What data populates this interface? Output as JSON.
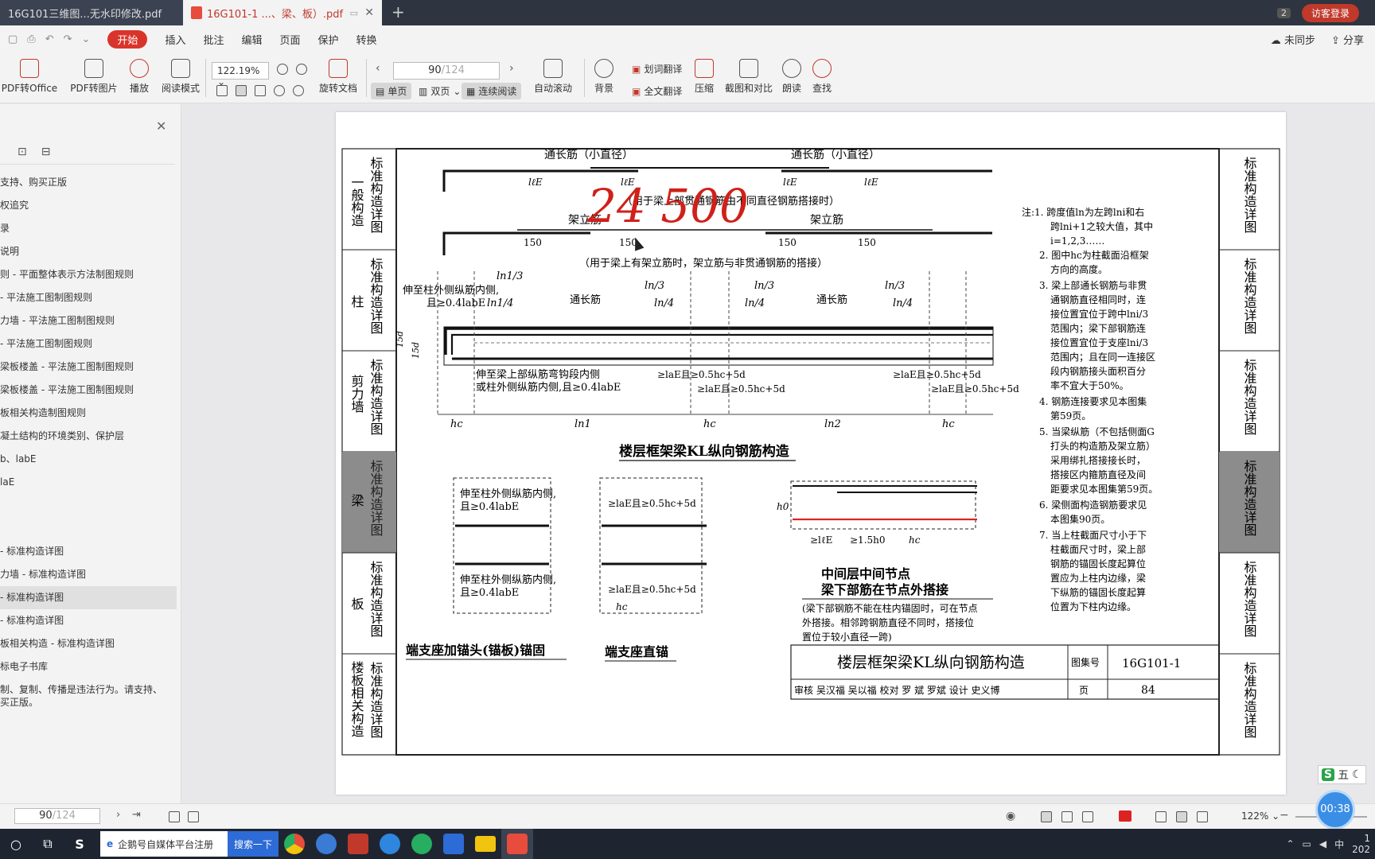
{
  "tabs": [
    {
      "label": "16G101三维图...无水印修改.pdf"
    },
    {
      "label": "16G101-1 ...、梁、板）.pdf"
    }
  ],
  "tabbar": {
    "badge": "2",
    "login": "访客登录"
  },
  "menu": {
    "items": [
      "开始",
      "插入",
      "批注",
      "编辑",
      "页面",
      "保护",
      "转换"
    ],
    "sync": "未同步",
    "share": "分享"
  },
  "toolbar": {
    "pdf_office": "PDF转Office",
    "pdf_image": "PDF转图片",
    "play": "播放",
    "read_mode": "阅读模式",
    "zoom": "122.19%",
    "rotate": "旋转文档",
    "page_current": "90",
    "page_total": "/124",
    "single": "单页",
    "double": "双页",
    "continuous": "连续阅读",
    "autoscroll": "自动滚动",
    "background": "背景",
    "word_translate": "划词翻译",
    "full_translate": "全文翻译",
    "compress": "压缩",
    "screenshot_compare": "截图和对比",
    "read_aloud": "朗读",
    "find": "查找"
  },
  "sidebar": {
    "items": [
      {
        "label": "支持、购买正版"
      },
      {
        "label": "权追究"
      },
      {
        "label": "录"
      },
      {
        "label": "说明"
      },
      {
        "label": "则 - 平面整体表示方法制图规则"
      },
      {
        "label": " - 平法施工图制图规则"
      },
      {
        "label": "力墙 - 平法施工图制图规则"
      },
      {
        "label": " - 平法施工图制图规则"
      },
      {
        "label": "梁板楼盖 - 平法施工图制图规则"
      },
      {
        "label": "梁板楼盖 - 平法施工图制图规则"
      },
      {
        "label": "板相关构造制图规则"
      },
      {
        "label": "凝土结构的环境类别、保护层"
      },
      {
        "label": "b、labE"
      },
      {
        "label": " laE"
      },
      {
        "label": ""
      },
      {
        "label": ""
      },
      {
        "label": " - 标准构造详图"
      },
      {
        "label": "力墙 - 标准构造详图"
      },
      {
        "label": " - 标准构造详图"
      },
      {
        "label": " - 标准构造详图"
      },
      {
        "label": "板相关构造 - 标准构造详图"
      },
      {
        "label": "标电子书库"
      },
      {
        "label": "制、复制、传播是违法行为。请支持、"
      },
      {
        "label": "买正版。"
      }
    ]
  },
  "drawing": {
    "left_tabs": [
      "一般构造",
      "柱",
      "剪力墙",
      "梁",
      "板",
      "楼板相关构造"
    ],
    "side_word": "标准构造详图",
    "top_label_1": "通长筋（小直径）",
    "top_label_2": "通长筋（小直径）",
    "note_1": "（用于梁上部贯通钢筋由不同直径钢筋搭接时）",
    "jlj_1": "架立筋",
    "jlj_2": "架立筋",
    "note_2": "（用于梁上有架立筋时，架立筋与非贯通钢筋的搭接）",
    "v150": "150",
    "lle": "lℓE",
    "ln1_3": "ln1/3",
    "ln1_4": "ln1/4",
    "ln_3": "ln/3",
    "ln_4": "ln/4",
    "tcj": "通长筋",
    "ext_col": "伸至柱外侧纵筋内侧,",
    "ext_col2": "且≥0.4labE",
    "ext_beam": "伸至梁上部纵筋弯钩段内侧",
    "ext_beam2": "或柱外侧纵筋内侧,且≥0.4labE",
    "lae_05": "≥laE且≥0.5hc+5d",
    "d15": "15d",
    "hc": "hc",
    "ln1": "ln1",
    "ln2": "ln2",
    "h0": "h0",
    "l15h0": "≥1.5h0",
    "lle2": "≥lℓE",
    "main_title": "楼层框架梁KL纵向钢筋构造",
    "mid_title_1": "中间层中间节点",
    "mid_title_2": "梁下部筋在节点外搭接",
    "mid_note_1": "(梁下部钢筋不能在柱内锚固时，可在节点",
    "mid_note_2": "外搭接。相邻跨钢筋直径不同时，搭接位",
    "mid_note_3": "置位于较小直径一跨)",
    "end_anchor_1": "端支座加锚头(锚板)锚固",
    "end_anchor_2": "端支座直锚",
    "notes": [
      "注:1. 跨度值ln为左跨lni和右",
      "跨lni+1之较大值，其中",
      "i=1,2,3……",
      "2. 图中hc为柱截面沿框架",
      "方向的高度。",
      "3. 梁上部通长钢筋与非贯",
      "通钢筋直径相同时，连",
      "接位置宜位于跨中lni/3",
      "范围内；梁下部钢筋连",
      "接位置宜位于支座lni/3",
      "范围内；且在同一连接区",
      "段内钢筋接头面积百分",
      "率不宜大于50%。",
      "4. 钢筋连接要求见本图集",
      "第59页。",
      "5. 当梁纵筋（不包括侧面G",
      "打头的构造筋及架立筋）",
      "采用绑扎搭接接长时，",
      "搭接区内箍筋直径及间",
      "距要求见本图集第59页。",
      "6. 梁侧面构造钢筋要求见",
      "本图集90页。",
      "7. 当上柱截面尺寸小于下",
      "柱截面尺寸时，梁上部",
      "钢筋的锚固长度起算位",
      "置应为上柱内边缘，梁",
      "下纵筋的锚固长度起算",
      "位置为下柱内边缘。"
    ],
    "titleblock": {
      "title": "楼层框架梁KL纵向钢筋构造",
      "atlas_label": "图集号",
      "atlas": "16G101-1",
      "page_label": "页",
      "page": "84",
      "row": "审核 吴汉福 吴以福 校对 罗 斌 罗斌 设计 史义博"
    },
    "handwriting": "24 500"
  },
  "status": {
    "page_current": "90",
    "page_total": "/124",
    "zoom": "122%"
  },
  "overlay": {
    "timer": "00:38",
    "ime": "五"
  },
  "taskbar": {
    "search_text": "企鹅号自媒体平台注册",
    "search_btn": "搜索一下",
    "tray_1": "1",
    "tray_2": "202"
  }
}
